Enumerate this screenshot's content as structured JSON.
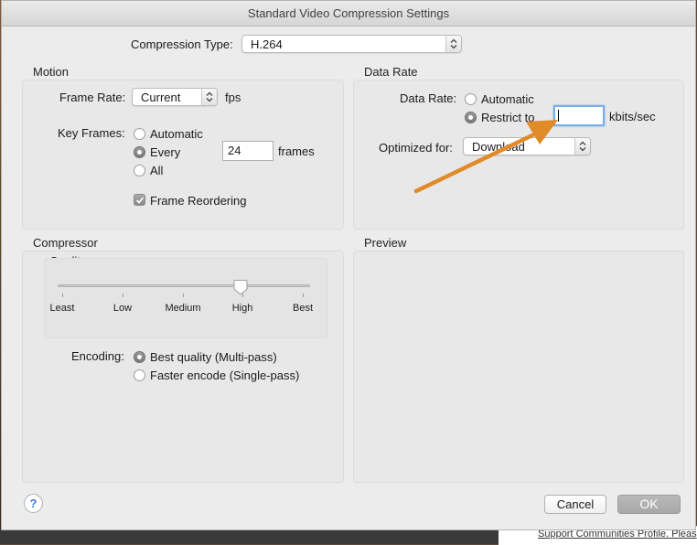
{
  "window": {
    "title": "Standard Video Compression Settings"
  },
  "compression": {
    "label": "Compression Type:",
    "value": "H.264"
  },
  "motion": {
    "title": "Motion",
    "frame_rate_label": "Frame Rate:",
    "frame_rate_value": "Current",
    "frame_rate_unit": "fps",
    "key_frames_label": "Key Frames:",
    "key_frames_options": [
      "Automatic",
      "Every",
      "All"
    ],
    "key_frames_selected": "Every",
    "key_frames_every_value": "24",
    "key_frames_unit": "frames",
    "frame_reordering_label": "Frame Reordering",
    "frame_reordering_checked": true
  },
  "data_rate": {
    "title": "Data Rate",
    "label": "Data Rate:",
    "options": [
      "Automatic",
      "Restrict to"
    ],
    "selected": "Restrict to",
    "restrict_value": "",
    "unit": "kbits/sec",
    "optimized_label": "Optimized for:",
    "optimized_value": "Download"
  },
  "compressor": {
    "title": "Compressor",
    "quality_label": "Quality",
    "quality_ticks": [
      "Least",
      "Low",
      "Medium",
      "High",
      "Best"
    ],
    "quality_selected": "High",
    "encoding_label": "Encoding:",
    "encoding_options": [
      "Best quality (Multi-pass)",
      "Faster encode (Single-pass)"
    ],
    "encoding_selected": "Best quality (Multi-pass)"
  },
  "preview": {
    "title": "Preview"
  },
  "buttons": {
    "help": "?",
    "cancel": "Cancel",
    "ok": "OK"
  },
  "background": {
    "link_text": "Support Communities Profile. Pleas"
  },
  "annotation": {
    "arrow_color": "#e08a28"
  }
}
